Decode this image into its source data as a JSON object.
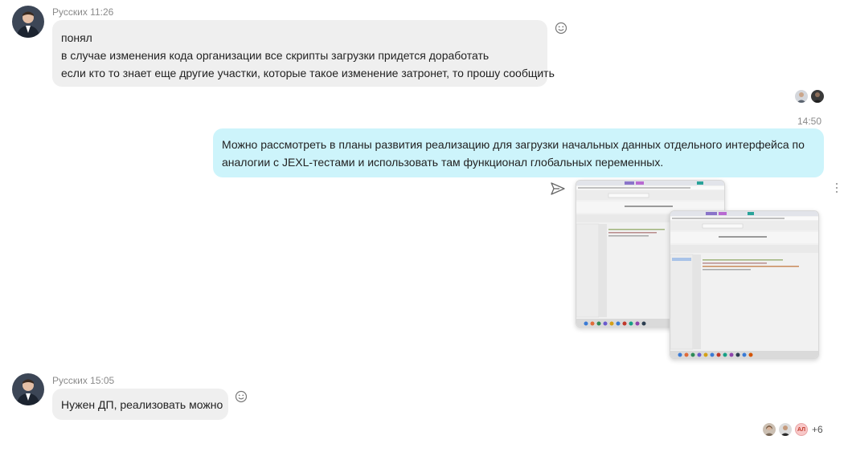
{
  "messages": [
    {
      "author": "Русских",
      "time": "11:26",
      "lines": [
        "понял",
        "в случае изменения кода организации все скрипты загрузки придется доработать",
        "если кто то знает еще другие участки, которые такое изменение затронет, то прошу сообщить"
      ]
    },
    {
      "time": "14:50",
      "lines": [
        "Можно рассмотреть в планы развития реализацию для загрузки начальных данных отдельного интерфейса по",
        "аналогии с JEXL-тестами и использовать там функционал глобальных переменных."
      ]
    },
    {
      "author": "Русских",
      "time": "15:05",
      "lines": [
        "Нужен ДП, реализовать можно"
      ]
    }
  ],
  "seen": {
    "initials": "АЛ",
    "more_count": "+6"
  },
  "icons": {
    "reaction": "smiley-icon",
    "send": "send-icon",
    "more": "kebab-icon"
  },
  "colors": {
    "incoming_bubble": "#efefef",
    "outgoing_bubble": "#cdf4fb",
    "meta_text": "#8a8a8a",
    "initials_badge": "#f8c8c8"
  }
}
